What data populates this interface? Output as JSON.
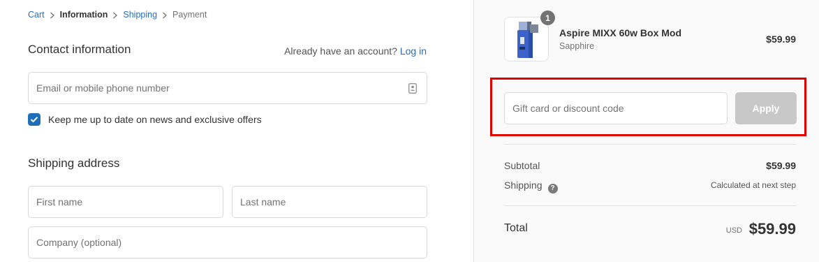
{
  "breadcrumb": {
    "cart": "Cart",
    "information": "Information",
    "shipping": "Shipping",
    "payment": "Payment"
  },
  "contact": {
    "title": "Contact information",
    "account_prompt": "Already have an account?",
    "login_link": "Log in",
    "email_placeholder": "Email or mobile phone number",
    "newsletter_label": "Keep me up to date on news and exclusive offers",
    "newsletter_checked": true
  },
  "shipping_address": {
    "title": "Shipping address",
    "first_name_placeholder": "First name",
    "last_name_placeholder": "Last name",
    "company_placeholder": "Company (optional)"
  },
  "order_summary": {
    "product": {
      "name": "Aspire MIXX 60w Box Mod",
      "variant": "Sapphire",
      "price": "$59.99",
      "quantity": "1"
    },
    "discount": {
      "placeholder": "Gift card or discount code",
      "apply_label": "Apply"
    },
    "subtotal_label": "Subtotal",
    "subtotal_value": "$59.99",
    "shipping_label": "Shipping",
    "shipping_help_icon": "question-icon",
    "shipping_value": "Calculated at next step",
    "total_label": "Total",
    "currency": "USD",
    "total_value": "$59.99"
  },
  "colors": {
    "link": "#2a6ebb",
    "checkbox": "#1f6fb8",
    "highlight": "#e00000",
    "apply_disabled": "#c8c8c8"
  }
}
